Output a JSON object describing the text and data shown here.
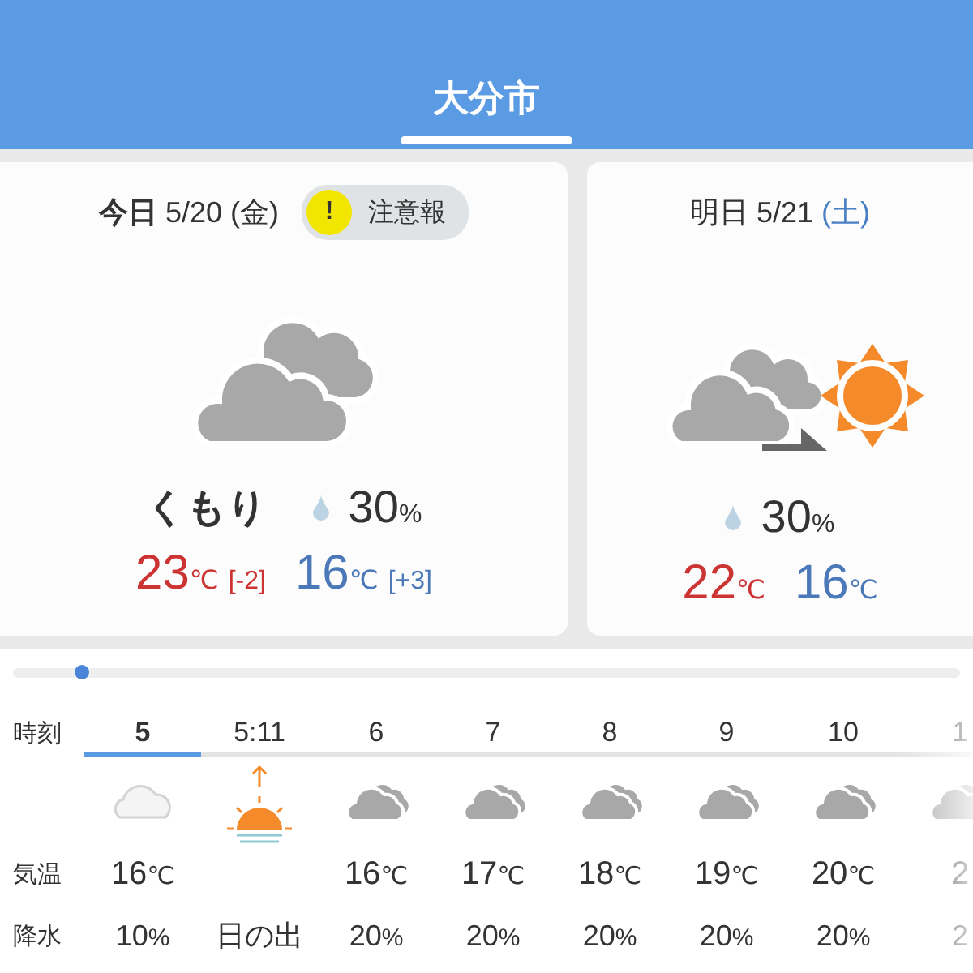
{
  "header": {
    "title": "大分市"
  },
  "today": {
    "label": "**今日** 5/20",
    "weekday": "(金)",
    "saturday": false,
    "warning": {
      "icon": "!",
      "label": "注意報"
    },
    "condition": "くもり",
    "rain": {
      "value": "30",
      "unit": "%"
    },
    "high": {
      "value": "23",
      "unit": "℃",
      "diff": "[-2]"
    },
    "low": {
      "value": "16",
      "unit": "℃",
      "diff": "[+3]"
    }
  },
  "tomorrow": {
    "label": "明日 5/21",
    "weekday": "(土)",
    "saturday": true,
    "rain": {
      "value": "30",
      "unit": "%"
    },
    "high": {
      "value": "22",
      "unit": "℃"
    },
    "low": {
      "value": "16",
      "unit": "℃"
    }
  },
  "hourly": {
    "row_labels": [
      "時刻",
      "気温",
      "降水"
    ],
    "columns": [
      {
        "kind": "weather",
        "time": "5",
        "temp": {
          "value": "16",
          "unit": "℃"
        },
        "rain": {
          "value": "10",
          "unit": "%"
        },
        "selected": true,
        "dimmed": true
      },
      {
        "kind": "sunrise",
        "time": "5:11",
        "label": "日の出",
        "selected": false
      },
      {
        "kind": "weather",
        "time": "6",
        "temp": {
          "value": "16",
          "unit": "℃"
        },
        "rain": {
          "value": "20",
          "unit": "%"
        },
        "selected": false,
        "dimmed": false
      },
      {
        "kind": "weather",
        "time": "7",
        "temp": {
          "value": "17",
          "unit": "℃"
        },
        "rain": {
          "value": "20",
          "unit": "%"
        },
        "selected": false,
        "dimmed": false
      },
      {
        "kind": "weather",
        "time": "8",
        "temp": {
          "value": "18",
          "unit": "℃"
        },
        "rain": {
          "value": "20",
          "unit": "%"
        },
        "selected": false,
        "dimmed": false
      },
      {
        "kind": "weather",
        "time": "9",
        "temp": {
          "value": "19",
          "unit": "℃"
        },
        "rain": {
          "value": "20",
          "unit": "%"
        },
        "selected": false,
        "dimmed": false
      },
      {
        "kind": "weather",
        "time": "10",
        "temp": {
          "value": "20",
          "unit": "℃"
        },
        "rain": {
          "value": "20",
          "unit": "%"
        },
        "selected": false,
        "dimmed": false
      },
      {
        "kind": "weather",
        "time": "1",
        "temp": {
          "value": "2"
        },
        "rain": {
          "value": "2"
        },
        "selected": false,
        "dimmed": false
      }
    ]
  }
}
